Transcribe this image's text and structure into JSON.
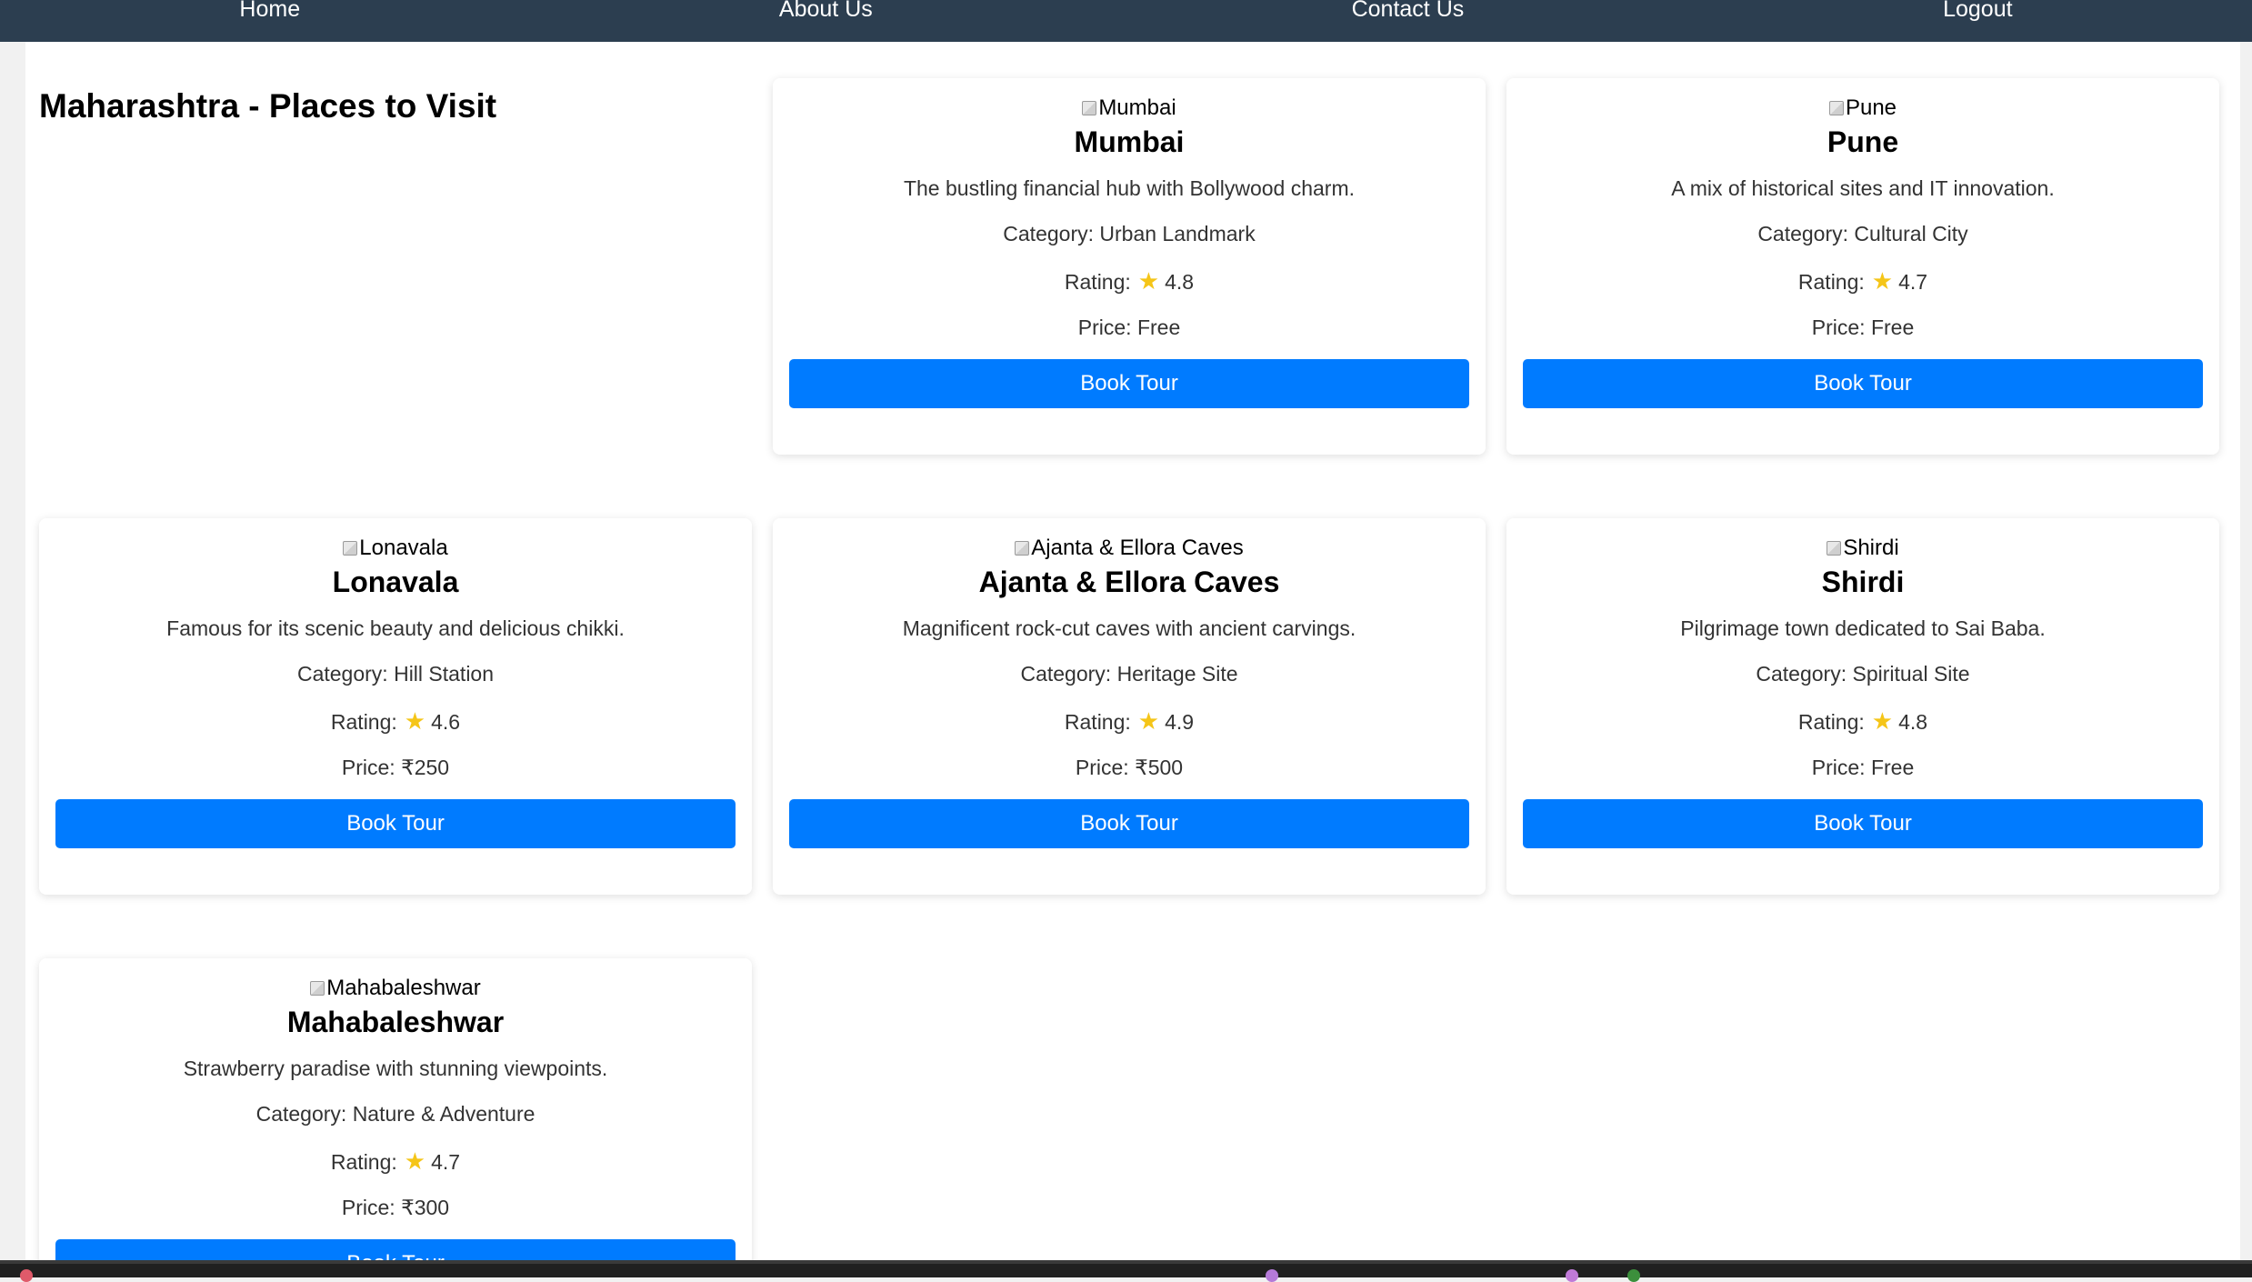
{
  "nav": {
    "items": [
      {
        "label": "Home"
      },
      {
        "label": "About Us"
      },
      {
        "label": "Contact Us"
      },
      {
        "label": "Logout"
      }
    ]
  },
  "page": {
    "title": "Maharashtra - Places to Visit"
  },
  "labels": {
    "category_prefix": "Category: ",
    "rating_prefix": "Rating:",
    "price_prefix": "Price: ",
    "book_button": "Book Tour"
  },
  "places": [
    {
      "name": "Mumbai",
      "image_alt": "Mumbai",
      "description": "The bustling financial hub with Bollywood charm.",
      "category": "Urban Landmark",
      "rating": "4.8",
      "price": "Free"
    },
    {
      "name": "Pune",
      "image_alt": "Pune",
      "description": "A mix of historical sites and IT innovation.",
      "category": "Cultural City",
      "rating": "4.7",
      "price": "Free"
    },
    {
      "name": "Lonavala",
      "image_alt": "Lonavala",
      "description": "Famous for its scenic beauty and delicious chikki.",
      "category": "Hill Station",
      "rating": "4.6",
      "price": "₹250"
    },
    {
      "name": "Ajanta & Ellora Caves",
      "image_alt": "Ajanta & Ellora Caves",
      "description": "Magnificent rock-cut caves with ancient carvings.",
      "category": "Heritage Site",
      "rating": "4.9",
      "price": "₹500"
    },
    {
      "name": "Shirdi",
      "image_alt": "Shirdi",
      "description": "Pilgrimage town dedicated to Sai Baba.",
      "category": "Spiritual Site",
      "rating": "4.8",
      "price": "Free"
    },
    {
      "name": "Mahabaleshwar",
      "image_alt": "Mahabaleshwar",
      "description": "Strawberry paradise with stunning viewpoints.",
      "category": "Nature & Adventure",
      "rating": "4.7",
      "price": "₹300"
    }
  ],
  "icons": {
    "star": "star-icon",
    "broken_image": "broken-image-icon"
  },
  "colors": {
    "nav_background": "#2c3e50",
    "button_primary": "#007bff",
    "star": "#f5c518"
  }
}
